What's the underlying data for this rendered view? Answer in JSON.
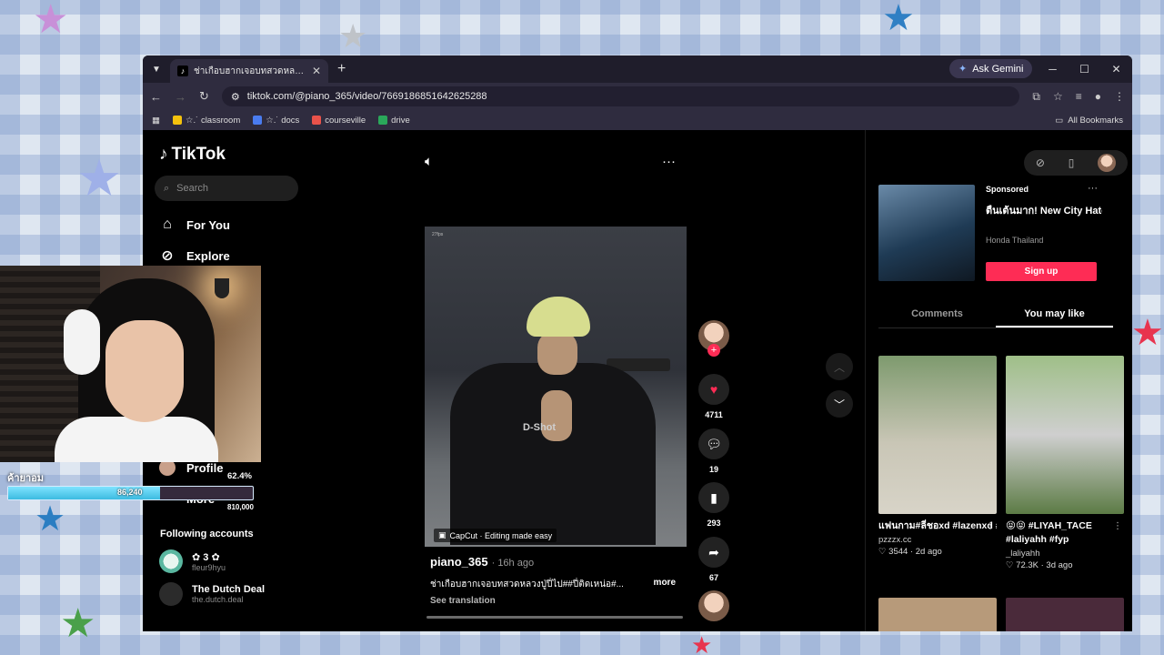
{
  "browser": {
    "tab_title": "ช่าเกือบฮากเจอบทสวดหลวงปู่ปี่ไป#ปี่ติดเหน่อ#",
    "ask_gemini": "Ask Gemini",
    "url": "tiktok.com/@piano_365/video/7669186851642625288",
    "bookmarks": [
      {
        "label": "☆.˙ classroom",
        "color": "#f4c20d"
      },
      {
        "label": "☆.˙ docs",
        "color": "#4a7cf0"
      },
      {
        "label": "courseville",
        "color": "#e9524a"
      },
      {
        "label": "drive",
        "color": "#2aa85a"
      }
    ],
    "all_bookmarks": "All Bookmarks"
  },
  "tiktok": {
    "logo": "TikTok",
    "search_placeholder": "Search",
    "nav": {
      "for_you": "For You",
      "explore": "Explore",
      "profile": "Profile",
      "more": "More"
    },
    "following_title": "Following accounts",
    "following": [
      {
        "name": "✿ 3 ✿",
        "handle": "fleur9hyu"
      },
      {
        "name": "The Dutch Deal",
        "handle": "the.dutch.deal"
      }
    ]
  },
  "video": {
    "fps_tag": "27fps",
    "overlay_text": "D-Shot",
    "capcut": "CapCut · Editing made easy",
    "author": "piano_365",
    "ago": "· 16h ago",
    "caption": "ช่าเกือบฮากเจอบทสวดหลวงปู่ปี่ไป##ปี่ติดเหน่อ#...",
    "more": "more",
    "see_translation": "See translation",
    "likes": "4711",
    "comments": "19",
    "saves": "293",
    "shares": "67",
    "like_color": "#fe2c55"
  },
  "right_panel": {
    "sponsored": "Sponsored",
    "ad_title": "ตื่นเต้นมาก! New City Hatchback รุ่นใหม่ ราค...",
    "ad_brand": "Honda Thailand",
    "sign_up": "Sign up",
    "tab_comments": "Comments",
    "tab_you_may_like": "You may like",
    "cards": [
      {
        "title": "แฟนกาม#ลี่ชอxd #lazenxd #เดโนซอ...",
        "user": "pzzzx.cc",
        "stats": "♡ 3544 · 2d ago"
      },
      {
        "title": "😝😝 #LIYAH_TACE #laliyahh #fyp",
        "user": "_laliyahh",
        "stats": "♡ 72.3K · 3d ago"
      }
    ]
  },
  "overlay": {
    "label": "ค้ายาอม",
    "goal_value": "86,240",
    "goal_fraction": 0.62,
    "profile_pct": "62.4%",
    "more_value": "810,000"
  }
}
